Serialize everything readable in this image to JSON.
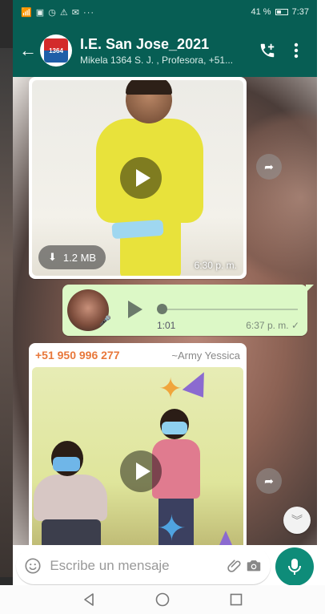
{
  "status_bar": {
    "left_icons": "📶 ▣ ◷ ⚠ ✉ ···",
    "battery": "41 %",
    "time": "7:37"
  },
  "header": {
    "title": "I.E. San Jose_2021",
    "subtitle": "Mikela 1364 S. J. , Profesora, +51...",
    "avatar_text": "1364"
  },
  "messages": [
    {
      "type": "video",
      "direction": "incoming",
      "size": "1.2 MB",
      "time": "6:30 p. m."
    },
    {
      "type": "voice",
      "direction": "outgoing",
      "duration": "1:01",
      "time": "6:37 p. m. ✓"
    },
    {
      "type": "video",
      "direction": "incoming",
      "sender_number": "+51 950 996 277",
      "sender_alias": "~Army Yessica"
    }
  ],
  "composer": {
    "placeholder": "Escribe un mensaje"
  },
  "colors": {
    "header": "#075e54",
    "outgoing_bubble": "#dcf8c6",
    "mic_button": "#0e8c79",
    "sender_name": "#e8773a"
  }
}
